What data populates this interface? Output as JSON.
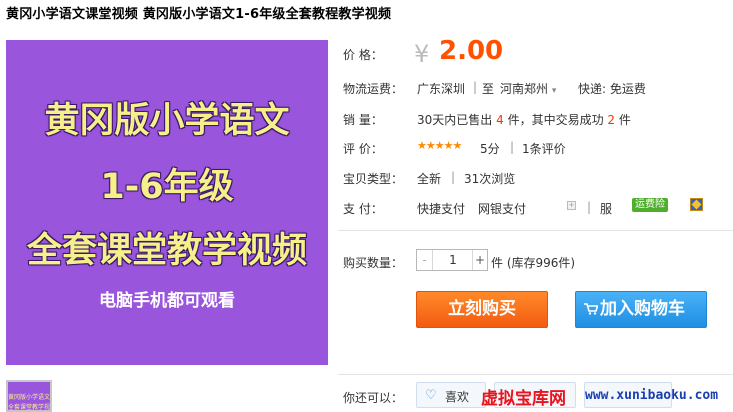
{
  "title": "黄冈小学语文课堂视频 黄冈版小学语文1-6年级全套教程教学视频",
  "image": {
    "line1": "黄冈版小学语文",
    "line2": "1-6年级",
    "line3": "全套课堂教学视频",
    "line4": "电脑手机都可观看"
  },
  "thumb": {
    "line1": "黄冈版小学语文",
    "line2": "全套课堂教学视频"
  },
  "price": {
    "label": "价 格：",
    "currency": "¥",
    "value": "2.00"
  },
  "shipping": {
    "label": "物流运费：",
    "from": "广东深圳",
    "to_word": "至",
    "to": "河南郑州",
    "courier": "快递: 免运费"
  },
  "sales": {
    "label": "销 量：",
    "prefix": "30天内已售出",
    "sold": "4",
    "mid": "件，其中交易成功",
    "success": "2",
    "suffix": "件"
  },
  "rating": {
    "label": "评 价：",
    "stars": "★★★★★",
    "score": "5分",
    "reviews": "1条评价"
  },
  "condition": {
    "label": "宝贝类型：",
    "type": "全新",
    "views": "31次浏览"
  },
  "payment": {
    "label": "支 付：",
    "method1": "快捷支付",
    "method2": "网银支付",
    "service": "服",
    "badge": "运费险"
  },
  "quantity": {
    "label": "购买数量：",
    "minus": "-",
    "value": "1",
    "plus": "+",
    "stock": "件 (库存996件)"
  },
  "buttons": {
    "buy_now": "立刻购买",
    "add_to_cart": "加入购物车"
  },
  "more": {
    "label": "你还可以：",
    "favorite": "喜欢"
  },
  "watermark": {
    "cn": "虚拟宝库网",
    "url": "www.xunibaoku.com"
  },
  "colors": {
    "price": "#ff5100",
    "buy": "#f35b10",
    "cart": "#1e8fe4",
    "image_bg": "#9a55dd"
  }
}
